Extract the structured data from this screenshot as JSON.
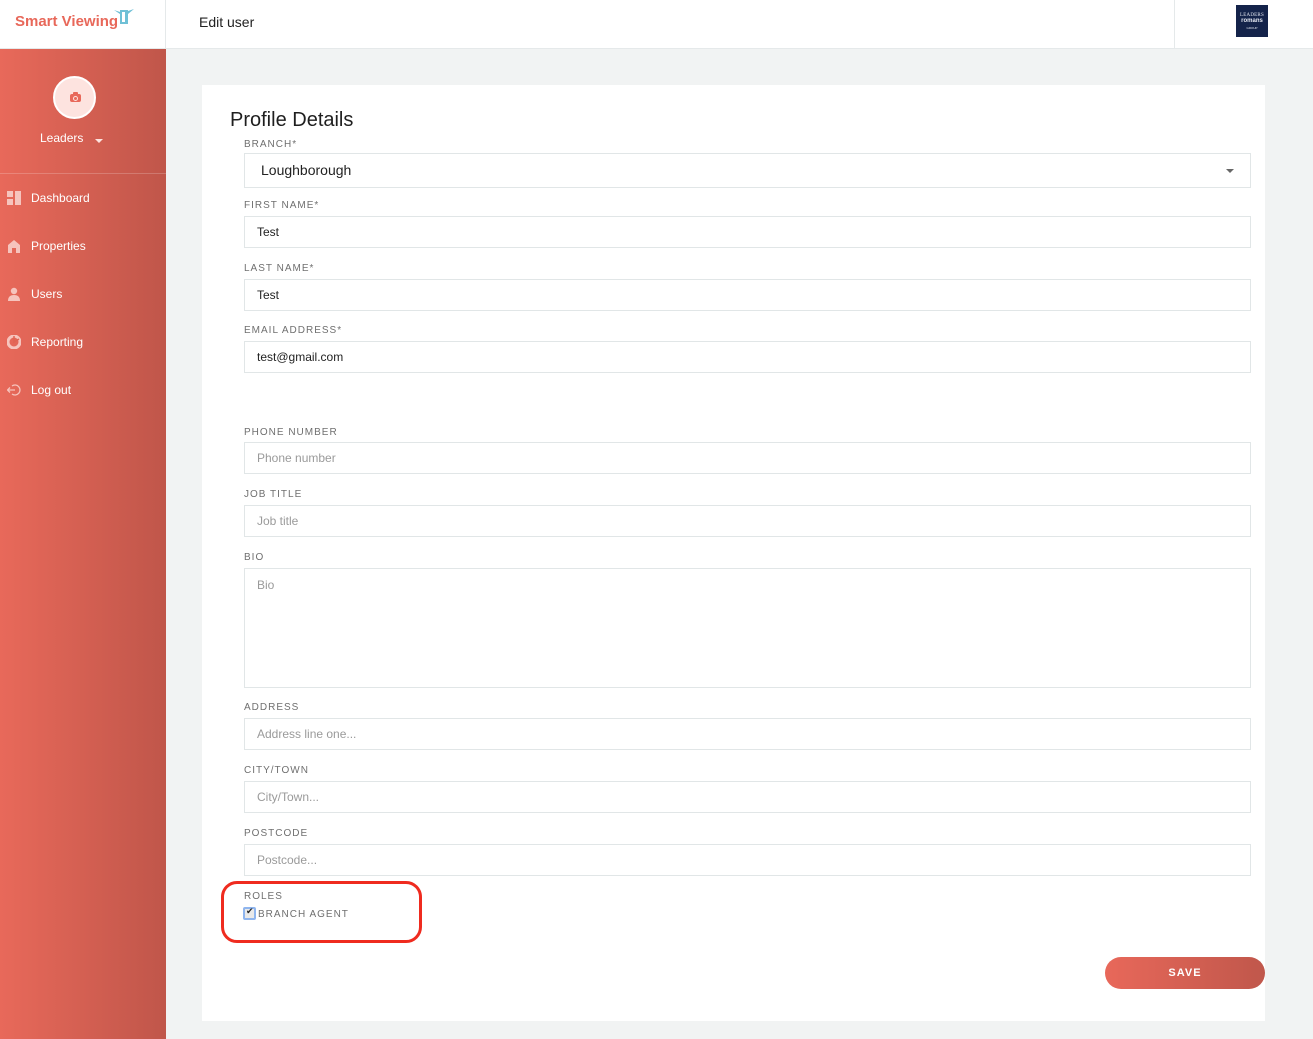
{
  "app": {
    "logo_text": "Smart Viewing",
    "page_title": "Edit user",
    "brand_badge": {
      "line1": "LEADERS",
      "line2": "romans",
      "line3": "GROUP"
    }
  },
  "sidebar": {
    "user_name": "Leaders",
    "items": [
      {
        "label": "Dashboard",
        "icon": "dashboard-icon"
      },
      {
        "label": "Properties",
        "icon": "home-icon"
      },
      {
        "label": "Users",
        "icon": "user-icon"
      },
      {
        "label": "Reporting",
        "icon": "pie-chart-icon"
      },
      {
        "label": "Log out",
        "icon": "logout-icon"
      }
    ]
  },
  "form": {
    "title": "Profile Details",
    "branch": {
      "label": "BRANCH*",
      "value": "Loughborough"
    },
    "first_name": {
      "label": "FIRST NAME*",
      "value": "Test"
    },
    "last_name": {
      "label": "LAST NAME*",
      "value": "Test"
    },
    "email": {
      "label": "EMAIL ADDRESS*",
      "value": "test@gmail.com"
    },
    "phone": {
      "label": "PHONE NUMBER",
      "placeholder": "Phone number"
    },
    "job_title": {
      "label": "JOB TITLE",
      "placeholder": "Job title"
    },
    "bio": {
      "label": "BIO",
      "placeholder": "Bio"
    },
    "address": {
      "label": "ADDRESS",
      "placeholder": "Address line one..."
    },
    "city": {
      "label": "CITY/TOWN",
      "placeholder": "City/Town..."
    },
    "postcode": {
      "label": "POSTCODE",
      "placeholder": "Postcode..."
    },
    "roles": {
      "label": "ROLES",
      "options": [
        {
          "label": "BRANCH AGENT",
          "checked": true
        }
      ]
    },
    "save_label": "SAVE"
  },
  "colors": {
    "accent": "#e8685a",
    "accent_dark": "#c0564a",
    "highlight": "#ef2b1f"
  }
}
